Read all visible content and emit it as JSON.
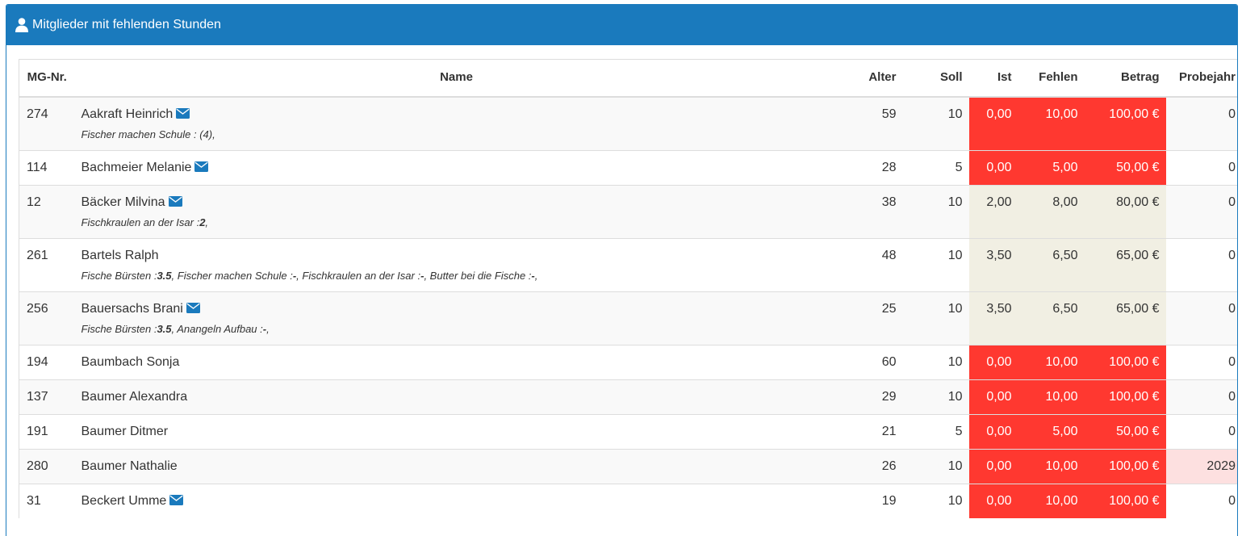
{
  "panel": {
    "title": "Mitglieder mit fehlenden Stunden",
    "title_icon": "user-icon",
    "header_color": "#1a7abd"
  },
  "table": {
    "headers": {
      "nr": "MG-Nr.",
      "name": "Name",
      "alter": "Alter",
      "soll": "Soll",
      "ist": "Ist",
      "fehlen": "Fehlen",
      "betrag": "Betrag",
      "probejahr": "Probejahr"
    },
    "colors": {
      "danger": "#ff3830",
      "warning": "#f1efe3",
      "pink": "#fde0e0"
    },
    "rows": [
      {
        "nr": "274",
        "name": "Aakraft Heinrich",
        "mail": true,
        "details": [
          {
            "label": "Fischer machen Schule : ",
            "value": "(4)"
          }
        ],
        "alter": "59",
        "soll": "10",
        "ist": "0,00",
        "fehlen": "10,00",
        "betrag": "100,00 €",
        "probejahr": "0",
        "status": "danger"
      },
      {
        "nr": "114",
        "name": "Bachmeier Melanie",
        "mail": true,
        "details": [],
        "alter": "28",
        "soll": "5",
        "ist": "0,00",
        "fehlen": "5,00",
        "betrag": "50,00 €",
        "probejahr": "0",
        "status": "danger"
      },
      {
        "nr": "12",
        "name": "Bäcker Milvina",
        "mail": true,
        "details": [
          {
            "label": "Fischkraulen an der Isar :",
            "value": "2",
            "bold": true
          }
        ],
        "alter": "38",
        "soll": "10",
        "ist": "2,00",
        "fehlen": "8,00",
        "betrag": "80,00 €",
        "probejahr": "0",
        "status": "warning"
      },
      {
        "nr": "261",
        "name": "Bartels Ralph",
        "mail": false,
        "details": [
          {
            "label": "Fische Bürsten :",
            "value": "3.5",
            "bold": true
          },
          {
            "label": "Fischer machen Schule :",
            "value": "-",
            "bold": true
          },
          {
            "label": "Fischkraulen an der Isar :",
            "value": "-",
            "bold": true
          },
          {
            "label": "Butter bei die Fische :",
            "value": "-",
            "bold": true
          }
        ],
        "alter": "48",
        "soll": "10",
        "ist": "3,50",
        "fehlen": "6,50",
        "betrag": "65,00 €",
        "probejahr": "0",
        "status": "warning"
      },
      {
        "nr": "256",
        "name": "Bauersachs Brani",
        "mail": true,
        "details": [
          {
            "label": "Fische Bürsten :",
            "value": "3.5",
            "bold": true
          },
          {
            "label": "Anangeln Aufbau :",
            "value": "-",
            "bold": true
          }
        ],
        "alter": "25",
        "soll": "10",
        "ist": "3,50",
        "fehlen": "6,50",
        "betrag": "65,00 €",
        "probejahr": "0",
        "status": "warning"
      },
      {
        "nr": "194",
        "name": "Baumbach Sonja",
        "mail": false,
        "details": [],
        "alter": "60",
        "soll": "10",
        "ist": "0,00",
        "fehlen": "10,00",
        "betrag": "100,00 €",
        "probejahr": "0",
        "status": "danger"
      },
      {
        "nr": "137",
        "name": "Baumer Alexandra",
        "mail": false,
        "details": [],
        "alter": "29",
        "soll": "10",
        "ist": "0,00",
        "fehlen": "10,00",
        "betrag": "100,00 €",
        "probejahr": "0",
        "status": "danger"
      },
      {
        "nr": "191",
        "name": "Baumer Ditmer",
        "mail": false,
        "details": [],
        "alter": "21",
        "soll": "5",
        "ist": "0,00",
        "fehlen": "5,00",
        "betrag": "50,00 €",
        "probejahr": "0",
        "status": "danger"
      },
      {
        "nr": "280",
        "name": "Baumer Nathalie",
        "mail": false,
        "details": [],
        "alter": "26",
        "soll": "10",
        "ist": "0,00",
        "fehlen": "10,00",
        "betrag": "100,00 €",
        "probejahr": "2029",
        "status": "danger",
        "probejahr_highlight": true
      },
      {
        "nr": "31",
        "name": "Beckert Umme",
        "mail": true,
        "details": [],
        "alter": "19",
        "soll": "10",
        "ist": "0,00",
        "fehlen": "10,00",
        "betrag": "100,00 €",
        "probejahr": "0",
        "status": "danger"
      }
    ]
  }
}
